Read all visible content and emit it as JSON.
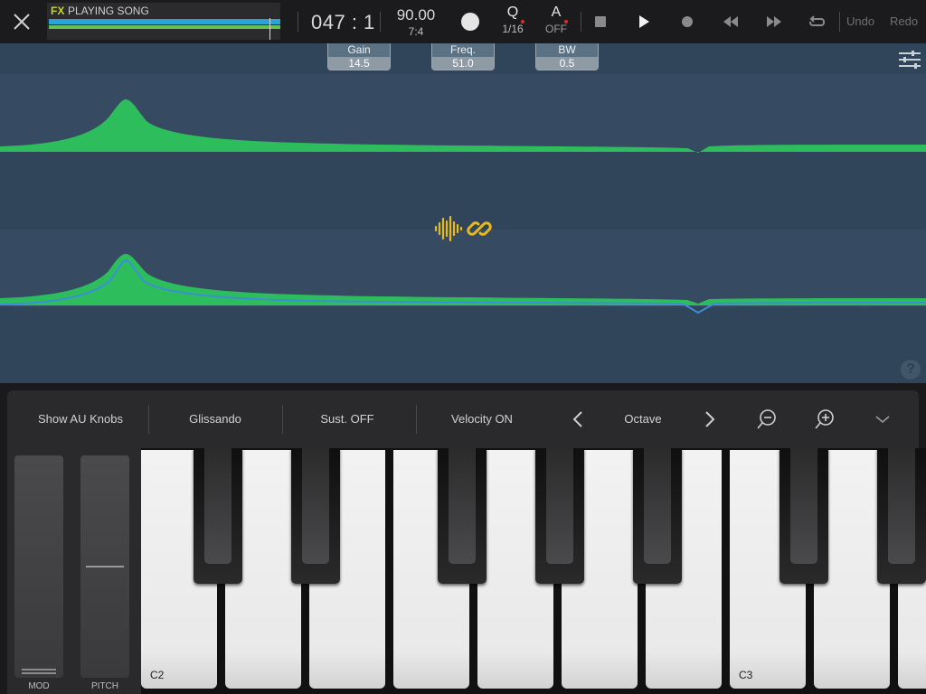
{
  "transport": {
    "track_label_fx": "FX",
    "track_label_status": "PLAYING SONG",
    "position": "047 : 1",
    "tempo": "90.00",
    "time_signature": "7:4",
    "quantize_label": "Q",
    "quantize_value": "1/16",
    "auto_label": "A",
    "auto_value": "OFF",
    "undo_label": "Undo",
    "redo_label": "Redo"
  },
  "eq": {
    "params": [
      {
        "label": "Gain",
        "value": "14.5"
      },
      {
        "label": "Freq.",
        "value": "51.0"
      },
      {
        "label": "BW",
        "value": "0.5"
      }
    ],
    "help_symbol": "?"
  },
  "keyboard_toolbar": {
    "show_au_knobs": "Show AU Knobs",
    "glissando": "Glissando",
    "sustain": "Sust. OFF",
    "velocity": "Velocity ON",
    "octave": "Octave"
  },
  "wheels": {
    "mod_label": "MOD",
    "pitch_label": "PITCH"
  },
  "keys": {
    "c2_label": "C2",
    "c3_label": "C3"
  },
  "colors": {
    "accent_yellow": "#e8b81c",
    "curve_green": "#2ebd5c",
    "curve_blue": "#3a8fd6",
    "eq_bg": "#30445a"
  },
  "icons": [
    "close-icon",
    "stop-icon",
    "play-icon",
    "record-icon",
    "rewind-icon",
    "fast-forward-icon",
    "loop-icon",
    "settings-sliders-icon",
    "waveform-icon",
    "link-icon",
    "help-icon",
    "chevron-left-icon",
    "chevron-right-icon",
    "zoom-out-icon",
    "zoom-in-icon",
    "chevron-down-icon"
  ]
}
